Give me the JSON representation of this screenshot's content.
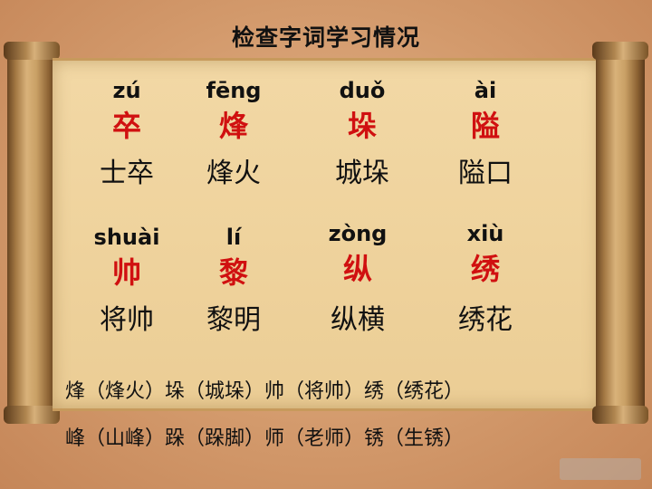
{
  "title": "检查字词学习情况",
  "row1": [
    {
      "pinyin": "zú",
      "char": "卒",
      "word": "士卒"
    },
    {
      "pinyin": "fēng",
      "char": "烽",
      "word": "烽火"
    },
    {
      "pinyin": "duǒ",
      "char": "垛",
      "word": "城垛"
    },
    {
      "pinyin": "ài",
      "char": "隘",
      "word": "隘口"
    }
  ],
  "row2": [
    {
      "pinyin": "shuài",
      "char": "帅",
      "word": "将帅"
    },
    {
      "pinyin": "lí",
      "char": "黎",
      "word": "黎明"
    },
    {
      "pinyin": "zòng",
      "char": "纵",
      "word": "纵横"
    },
    {
      "pinyin": "xiù",
      "char": "绣",
      "word": "绣花"
    }
  ],
  "lines": [
    "烽（烽火）垛（城垛）帅（将帅）绣（绣花）",
    "峰（山峰）跺（跺脚）师（老师）锈（生锈）"
  ]
}
